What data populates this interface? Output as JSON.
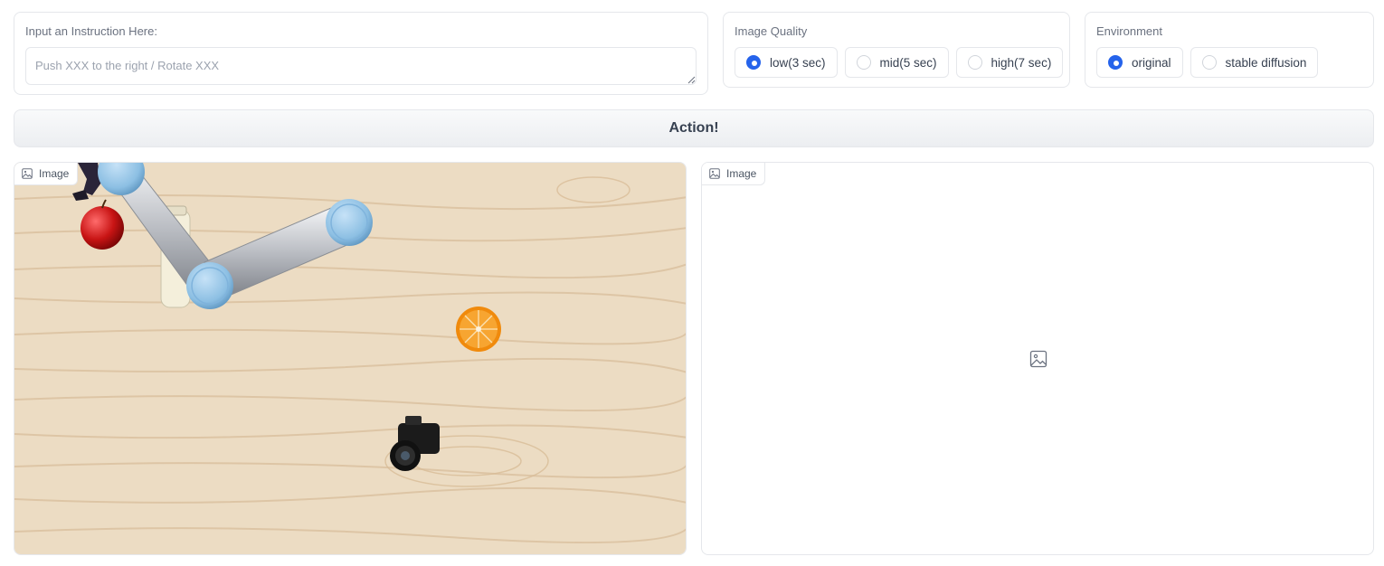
{
  "instruction": {
    "label": "Input an Instruction Here:",
    "placeholder": "Push XXX to the right / Rotate XXX",
    "value": ""
  },
  "image_quality": {
    "label": "Image Quality",
    "options": [
      "low(3 sec)",
      "mid(5 sec)",
      "high(7 sec)"
    ],
    "selected": "low(3 sec)"
  },
  "environment": {
    "label": "Environment",
    "options": [
      "original",
      "stable diffusion"
    ],
    "selected": "original"
  },
  "action_button": {
    "label": "Action!"
  },
  "input_image": {
    "label": "Image"
  },
  "output_image": {
    "label": "Image"
  },
  "colors": {
    "accent": "#2563eb",
    "border": "#e5e7eb",
    "table": "#ecdcc3"
  },
  "icons": [
    "image-icon",
    "resize-grip-icon"
  ]
}
